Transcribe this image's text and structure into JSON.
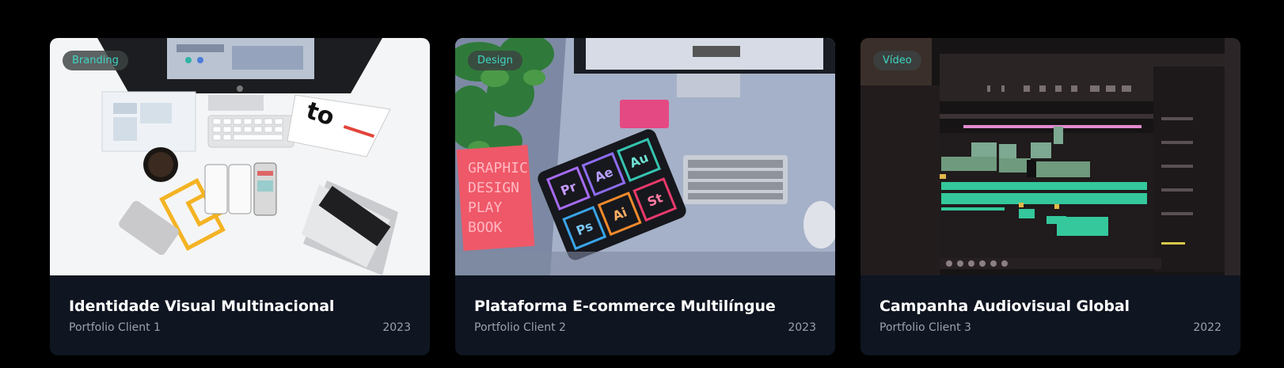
{
  "projects": [
    {
      "tag": "Branding",
      "title": "Identidade Visual Multinacional",
      "client": "Portfolio Client 1",
      "year": "2023",
      "image": "flat-lay white desk with iMac, keyboard, phone wireframes, coffee cup, laptop"
    },
    {
      "tag": "Design",
      "title": "Plataforma E-commerce Multilíngue",
      "client": "Portfolio Client 2",
      "year": "2023",
      "image": "desk with iMac, tablet showing Adobe app icons, design playbook, keyboard, plant",
      "tablet_icons": [
        "Pr",
        "Ae",
        "Au",
        "Ps",
        "Ai",
        "St"
      ],
      "book_text": [
        "GRAPHIC",
        "DESIGN",
        "PLAY",
        "BOOK"
      ]
    },
    {
      "tag": "Vídeo",
      "title": "Campanha Audiovisual Global",
      "client": "Portfolio Client 3",
      "year": "2022",
      "image": "video editing timeline on a monitor"
    }
  ],
  "colors": {
    "background": "#000000",
    "card": "#0f1521",
    "tag_text": "#3ed6c3",
    "meta_text": "#9aa2ae"
  }
}
